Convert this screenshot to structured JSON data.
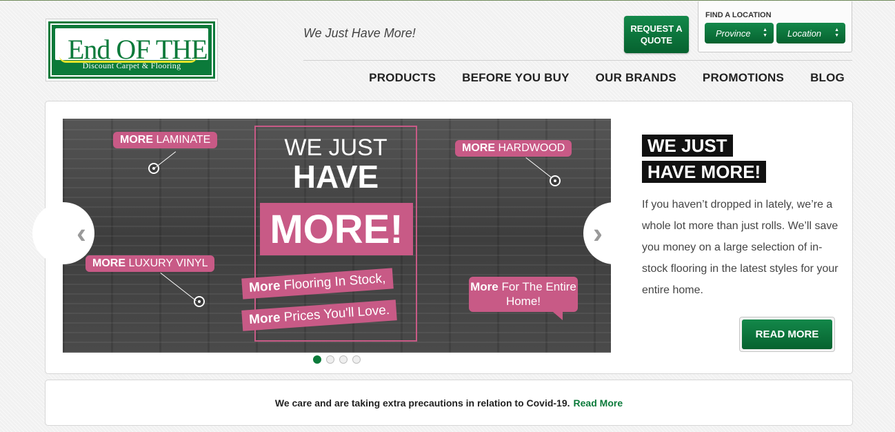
{
  "brand": {
    "logo_text": "End OF THE Roll",
    "logo_subtitle": "Discount Carpet & Flooring",
    "tagline": "We Just Have More!"
  },
  "header": {
    "quote_button": "REQUEST A QUOTE",
    "find_location": {
      "title": "FIND A LOCATION",
      "province": "Province",
      "location": "Location"
    }
  },
  "nav": {
    "items": [
      "PRODUCTS",
      "BEFORE YOU BUY",
      "OUR BRANDS",
      "PROMOTIONS",
      "BLOG"
    ]
  },
  "hero": {
    "slide": {
      "tag_laminate_bold": "MORE",
      "tag_laminate_rest": "LAMINATE",
      "tag_hardwood_bold": "MORE",
      "tag_hardwood_rest": "HARDWOOD",
      "tag_vinyl_bold": "MORE",
      "tag_vinyl_rest": "LUXURY VINYL",
      "we_just": "WE JUST",
      "have": "HAVE",
      "more": "MORE!",
      "line1_bold": "More",
      "line1_rest": "Flooring In Stock,",
      "line2_bold": "More",
      "line2_rest": "Prices You'll Love.",
      "bubble_bold": "More",
      "bubble_rest": "For The Entire Home!"
    },
    "pager": {
      "count": 4,
      "active": 1
    },
    "headline_line1": "WE JUST",
    "headline_line2": "HAVE MORE!",
    "body": "If you haven’t dropped in lately, we’re a whole lot more than just rolls. We’ll save you money on a large selection of in-stock flooring in the latest styles for your entire home.",
    "read_more": "READ MORE"
  },
  "notice": {
    "text": "We care and are taking extra precautions in relation to Covid-19.",
    "link": "Read More"
  },
  "colors": {
    "brand_green": "#0b7a3a",
    "accent_pink": "#c85a86",
    "logo_swoosh_yellow": "#e5e52b"
  }
}
